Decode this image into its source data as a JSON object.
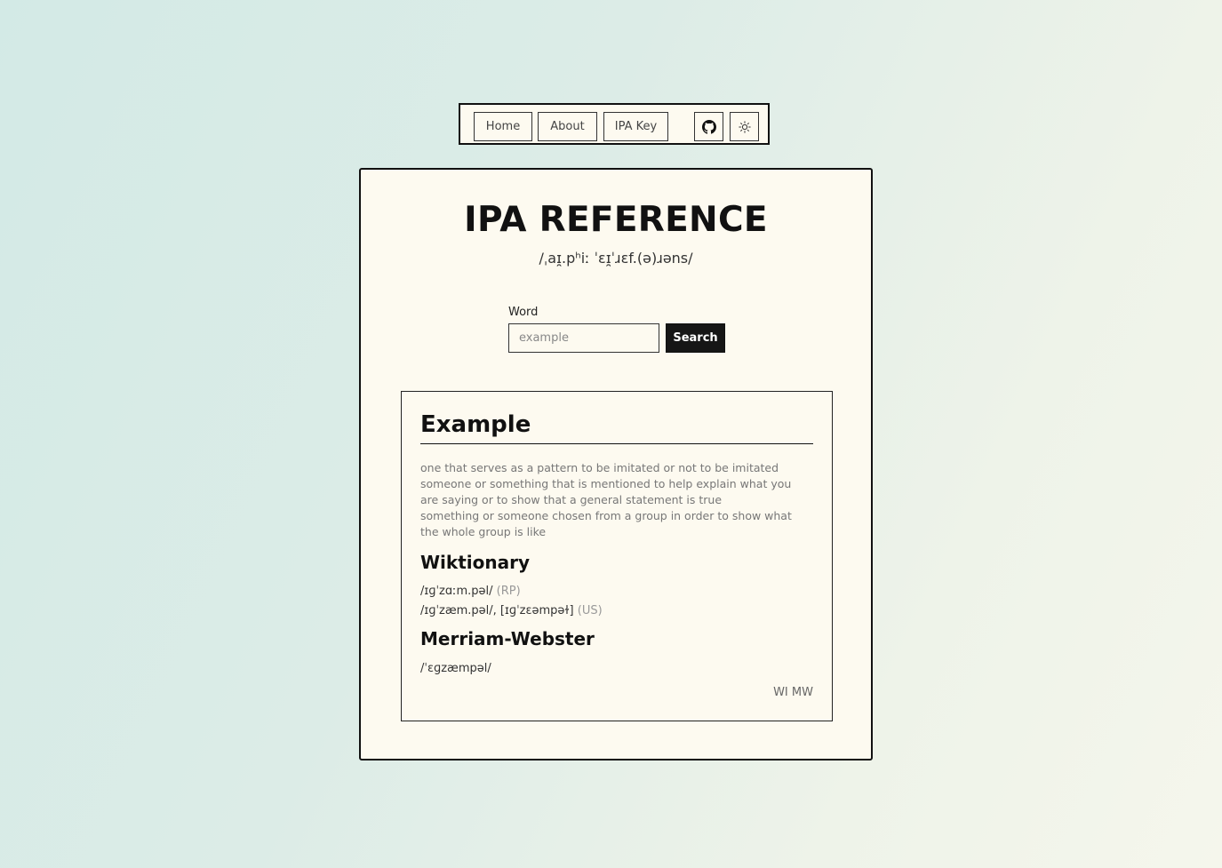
{
  "nav": {
    "home": "Home",
    "about": "About",
    "ipa_key": "IPA Key",
    "github_icon": "github-icon",
    "theme_icon": "sun-icon"
  },
  "header": {
    "title": "IPA REFERENCE",
    "pronunciation": "/ˌaɪ̯.pʰiː ˈɛɪ̯ˈɹɛf.(ə)ɹəns/"
  },
  "search": {
    "label": "Word",
    "placeholder": "example",
    "value": "",
    "button": "Search"
  },
  "result": {
    "word": "Example",
    "definitions": [
      "one that serves as a pattern to be imitated or not to be imitated",
      "someone or something that is mentioned to help explain what you are saying or to show that a general statement is true",
      "something or someone chosen from a group in order to show what the whole group is like"
    ],
    "wiktionary": {
      "title": "Wiktionary",
      "pronunciations": [
        {
          "ipa": "/ɪɡˈzɑːm.pəl/",
          "region": "(RP)"
        },
        {
          "ipa": "/ɪɡˈzæm.pəl/, [ɪɡˈzɛəmpəɫ]",
          "region": "(US)"
        }
      ]
    },
    "merriam_webster": {
      "title": "Merriam-Webster",
      "pronunciation": "/ˈɛɡzæmpəl/"
    },
    "sources": {
      "wi": "WI",
      "mw": "MW"
    }
  },
  "colors": {
    "card_bg": "#fdfaf0",
    "border": "#111111",
    "button_dark": "#161616",
    "muted_text": "#777777"
  }
}
